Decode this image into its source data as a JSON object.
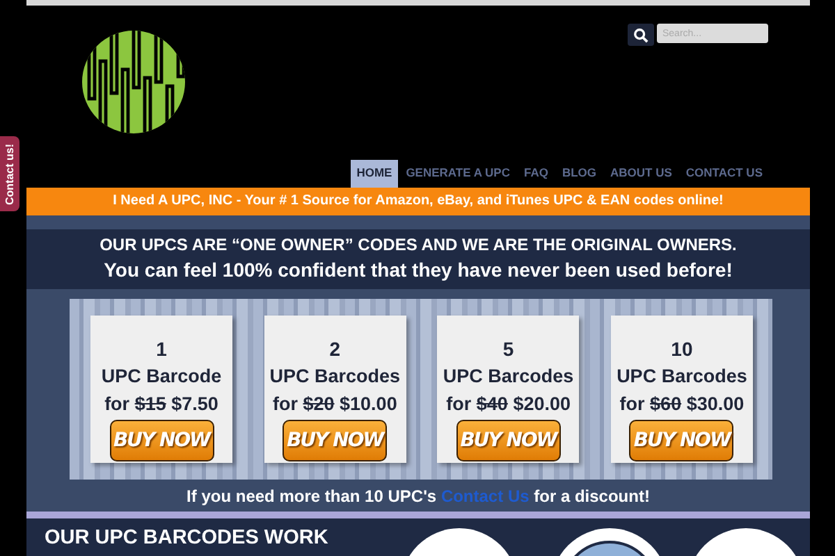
{
  "search": {
    "placeholder": "Search..."
  },
  "nav": [
    {
      "label": "HOME",
      "selected": true
    },
    {
      "label": "GENERATE A UPC",
      "selected": false
    },
    {
      "label": "FAQ",
      "selected": false
    },
    {
      "label": "BLOG",
      "selected": false
    },
    {
      "label": "ABOUT US",
      "selected": false
    },
    {
      "label": "CONTACT US",
      "selected": false
    }
  ],
  "contact_tab": "Contact us!",
  "banner": "I Need A UPC, INC - Your # 1 Source for Amazon, eBay, and iTunes UPC & EAN codes online!",
  "headline": "OUR UPCS ARE “ONE OWNER” CODES AND WE ARE THE ORIGINAL OWNERS.",
  "subheadline": "You can feel 100% confident that they have never been used before!",
  "packages": [
    {
      "count": "1",
      "unit": "UPC Barcode",
      "prefix": "for",
      "old_price": "$15",
      "price": "$7.50",
      "button": "BUY NOW"
    },
    {
      "count": "2",
      "unit": "UPC Barcodes",
      "prefix": "for",
      "old_price": "$20",
      "price": "$10.00",
      "button": "BUY NOW"
    },
    {
      "count": "5",
      "unit": "UPC Barcodes",
      "prefix": "for",
      "old_price": "$40",
      "price": "$20.00",
      "button": "BUY NOW"
    },
    {
      "count": "10",
      "unit": "UPC Barcodes",
      "prefix": "for",
      "old_price": "$60",
      "price": "$30.00",
      "button": "BUY NOW"
    }
  ],
  "discount": {
    "before": "If you need more than 10 UPC's",
    "link": "Contact Us",
    "after": "for a discount!"
  },
  "section_title": "OUR UPC BARCODES WORK"
}
